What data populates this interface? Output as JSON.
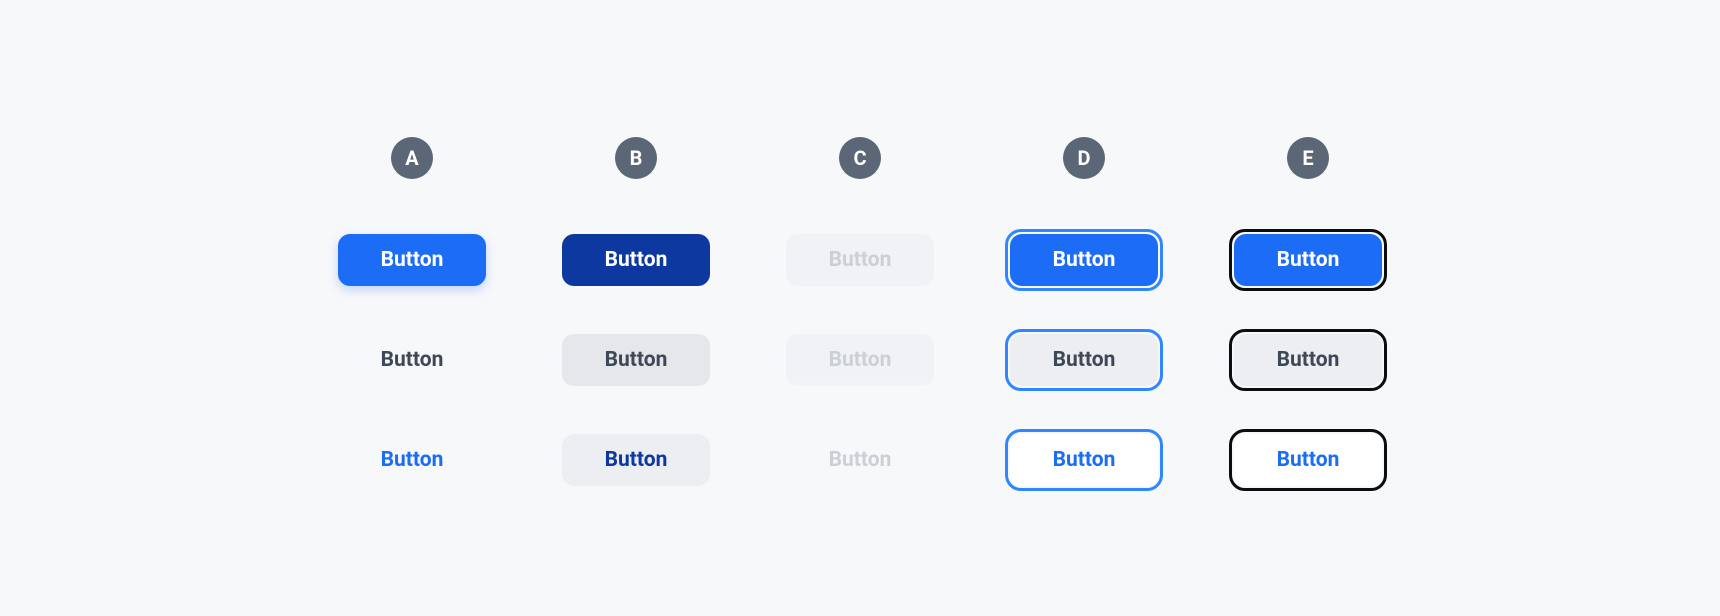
{
  "columns": {
    "a": {
      "letter": "A",
      "meaning": "default"
    },
    "b": {
      "letter": "B",
      "meaning": "pressed"
    },
    "c": {
      "letter": "C",
      "meaning": "disabled"
    },
    "d": {
      "letter": "D",
      "meaning": "focus-ring-blue"
    },
    "e": {
      "letter": "E",
      "meaning": "focus-ring-black"
    }
  },
  "variants": {
    "primary": "primary",
    "secondary": "secondary",
    "ghost": "ghost"
  },
  "label": "Button",
  "colors": {
    "blue_default": "#1c6cf5",
    "blue_pressed": "#0c389f",
    "focus_ring_blue": "#2f86ff",
    "focus_ring_black": "#0b0d10",
    "grey_bg": "#eceef1",
    "badge_bg": "#5b6676"
  }
}
